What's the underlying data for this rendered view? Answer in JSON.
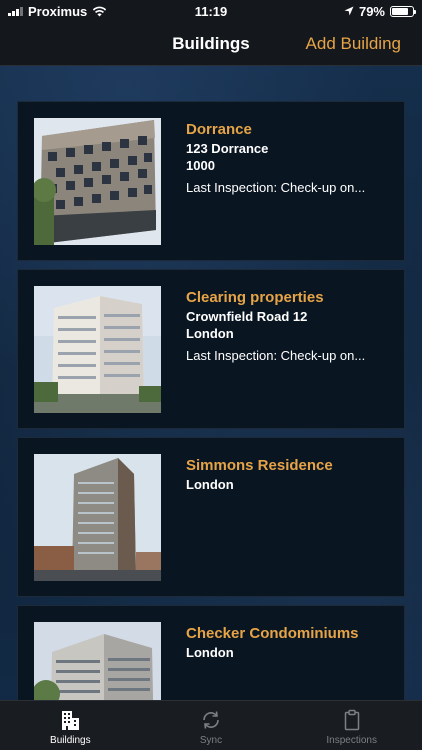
{
  "status_bar": {
    "carrier": "Proximus",
    "time": "11:19",
    "battery": "79%",
    "battery_level": 0.79,
    "icons": [
      "signal-icon",
      "wifi-icon",
      "location-arrow-icon",
      "battery-icon"
    ]
  },
  "nav": {
    "title": "Buildings",
    "add_label": "Add Building"
  },
  "buildings": [
    {
      "name": "Dorrance",
      "address": "123 Dorrance",
      "city": "1000",
      "inspection": "Last Inspection: Check-up on..."
    },
    {
      "name": "Clearing properties",
      "address": "Crownfield Road 12",
      "city": "London",
      "inspection": "Last Inspection: Check-up on..."
    },
    {
      "name": "Simmons Residence",
      "address": "",
      "city": "London",
      "inspection": ""
    },
    {
      "name": "Checker Condominiums",
      "address": "",
      "city": "London",
      "inspection": ""
    }
  ],
  "tabs": [
    {
      "label": "Buildings",
      "icon": "buildings-icon",
      "active": true
    },
    {
      "label": "Sync",
      "icon": "sync-icon",
      "active": false
    },
    {
      "label": "Inspections",
      "icon": "clipboard-icon",
      "active": false
    }
  ],
  "colors": {
    "accent": "#e6a446",
    "card_bg": "#0a1522",
    "bar_bg": "#14171c"
  }
}
